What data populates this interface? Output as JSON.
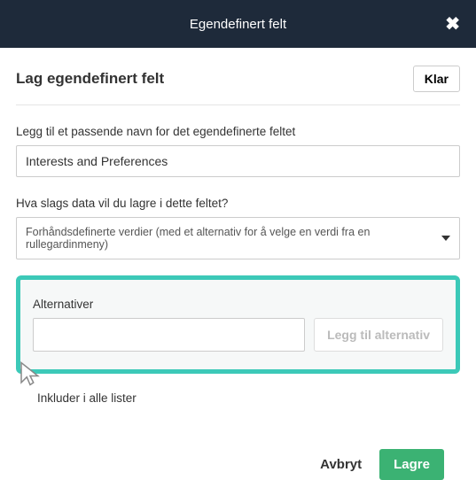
{
  "header": {
    "title": "Egendefinert felt"
  },
  "subheader": {
    "title": "Lag egendefinert felt",
    "klar_label": "Klar"
  },
  "name_field": {
    "label": "Legg til et passende navn for det egendefinerte feltet",
    "value": "Interests and Preferences"
  },
  "type_field": {
    "label": "Hva slags data vil du lagre i dette feltet?",
    "selected": "Forhåndsdefinerte verdier (med et alternativ for å velge en verdi fra en rullegardinmeny)"
  },
  "alternatives": {
    "label": "Alternativer",
    "input_value": "",
    "add_label": "Legg til alternativ"
  },
  "include_all": {
    "label": "Inkluder i alle lister"
  },
  "footer": {
    "cancel": "Avbryt",
    "save": "Lagre"
  }
}
